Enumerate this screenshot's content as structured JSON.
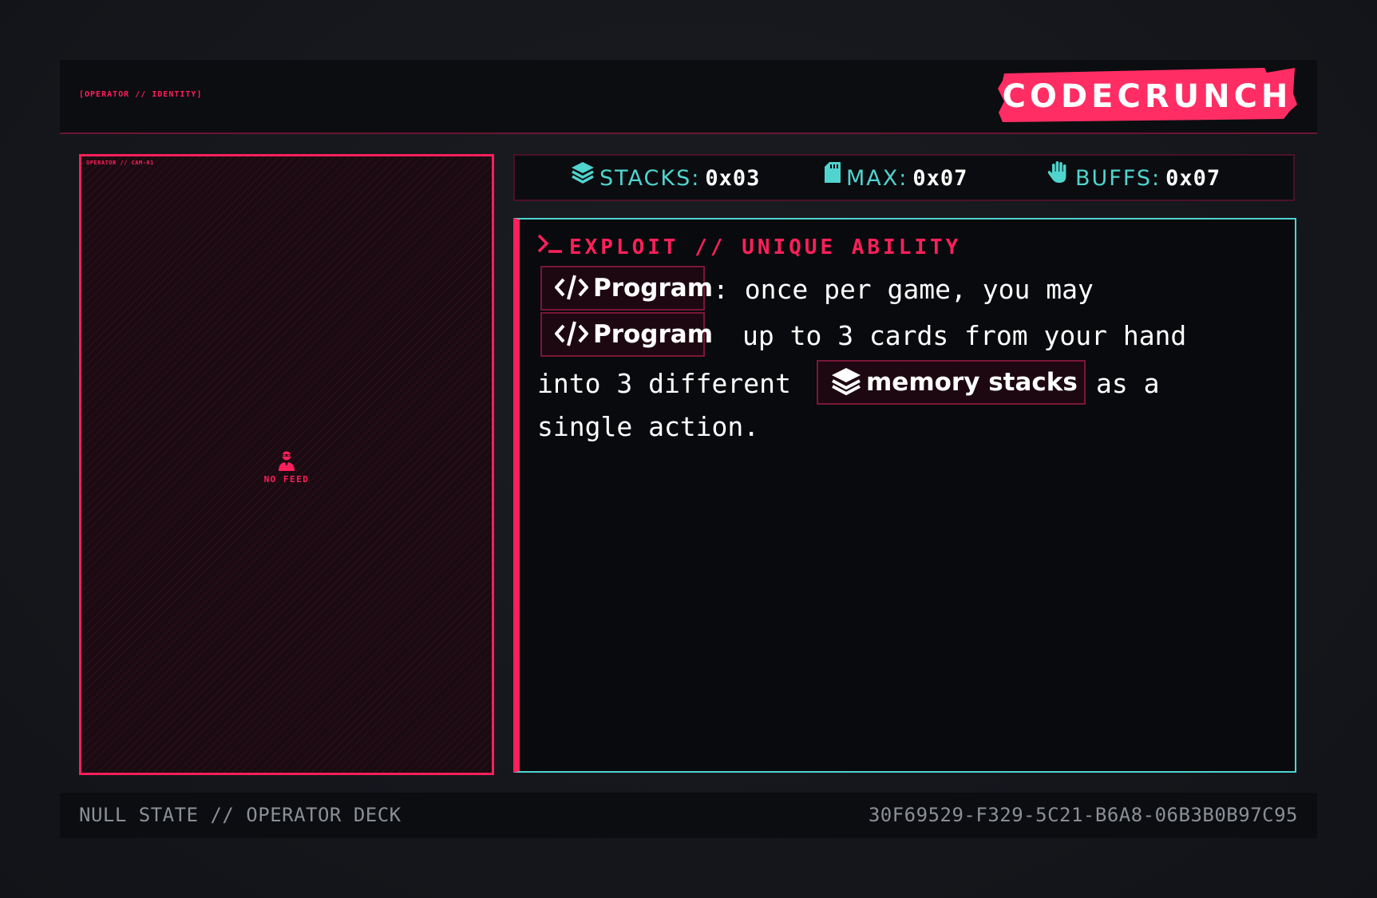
{
  "header": {
    "tag": "[OPERATOR // IDENTITY]",
    "brand": "CODECRUNCH",
    "brand_color": "#ff2d63"
  },
  "camera": {
    "tag": "OPERATOR // CAM-01",
    "no_feed_icon": "user-secret-icon",
    "no_feed_label": "NO FEED"
  },
  "stats": {
    "stacks": {
      "icon": "layers-icon",
      "label": "STACKS:",
      "value": "0x03"
    },
    "max": {
      "icon": "sd-card-icon",
      "label": "MAX:",
      "value": "0x07"
    },
    "buffs": {
      "icon": "hand-icon",
      "label": "BUFFS:",
      "value": "0x07"
    }
  },
  "ability": {
    "prompt_icon": "terminal-prompt-icon",
    "title": "EXPLOIT // UNIQUE ABILITY",
    "chip_program_1": {
      "icon": "code-icon",
      "label": "Program"
    },
    "text_1": ": once per game, you may",
    "chip_program_2": {
      "icon": "code-icon",
      "label": "Program"
    },
    "text_2": "up to 3 cards from your hand",
    "text_3": "into 3 different",
    "chip_memory": {
      "icon": "layers-icon",
      "label": "memory stacks"
    },
    "text_4": "as a",
    "text_5": "single action."
  },
  "footer": {
    "left": "NULL STATE // OPERATOR DECK",
    "right": "30F69529-F329-5C21-B6A8-06B3B0B97C95"
  },
  "colors": {
    "accent_pink": "#ff1f5a",
    "accent_cyan": "#4fd4cf",
    "background": "#14161b"
  }
}
